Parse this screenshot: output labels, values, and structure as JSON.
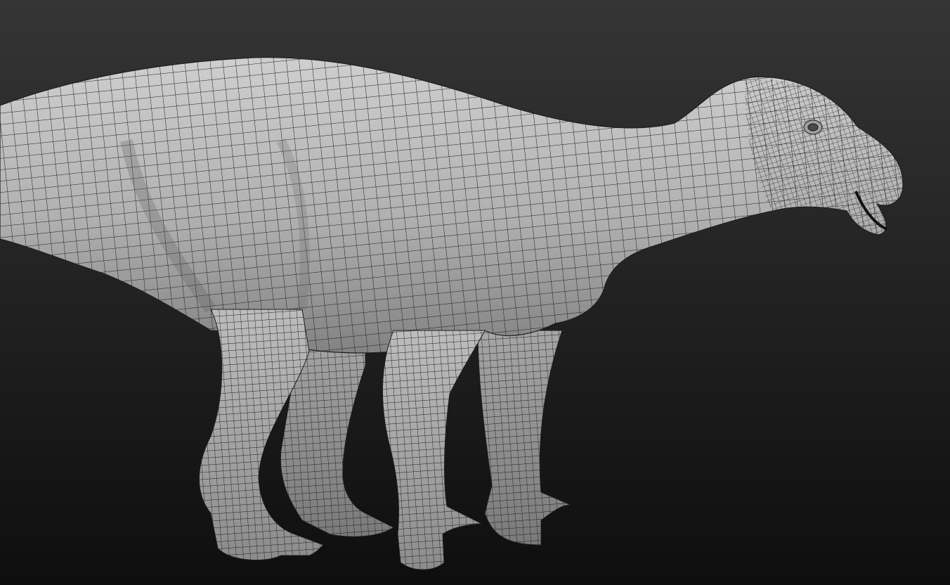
{
  "scene": {
    "subject": "dinosaur-wireframe-model",
    "colors": {
      "background_top": "#353535",
      "background_bottom": "#0e0e0e",
      "mesh_fill_light": "#c4c4c4",
      "mesh_fill_mid": "#9a9a9a",
      "mesh_fill_dark": "#6a6a6a",
      "wire": "#1e1e1e"
    }
  }
}
